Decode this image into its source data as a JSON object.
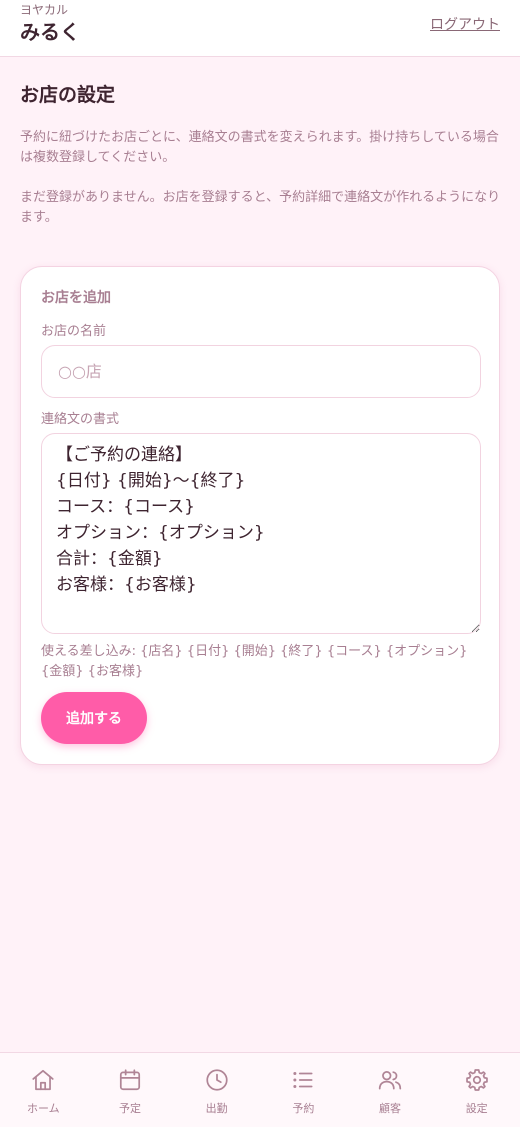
{
  "header": {
    "brand_kana": "ヨヤカル",
    "brand_name": "みるく",
    "logout_label": "ログアウト"
  },
  "page": {
    "title": "お店の設定",
    "description": "予約に紐づけたお店ごとに、連絡文の書式を変えられます。掛け持ちしている場合は複数登録してください。",
    "empty_message": "まだ登録がありません。お店を登録すると、予約詳細で連絡文が作れるようになります。"
  },
  "add_shop_form": {
    "title": "お店を追加",
    "name_label": "お店の名前",
    "name_placeholder": "○○店",
    "template_label": "連絡文の書式",
    "template_value": "【ご予約の連絡】\n{日付} {開始}〜{終了}\nコース：{コース}\nオプション：{オプション}\n合計：{金額}\nお客様：{お客様}",
    "placeholders_help": "使える差し込み: {店名} {日付} {開始} {終了} {コース} {オプション} {金額} {お客様}",
    "submit_label": "追加する"
  },
  "bottom_nav": {
    "items": [
      {
        "label": "ホーム",
        "icon": "home-icon"
      },
      {
        "label": "予定",
        "icon": "calendar-icon"
      },
      {
        "label": "出勤",
        "icon": "clock-icon"
      },
      {
        "label": "予約",
        "icon": "list-icon"
      },
      {
        "label": "顧客",
        "icon": "users-icon"
      },
      {
        "label": "設定",
        "icon": "gear-icon"
      }
    ]
  },
  "colors": {
    "accent": "#ff5ca8",
    "background": "#fff2f8",
    "muted_text": "#a87f92"
  }
}
